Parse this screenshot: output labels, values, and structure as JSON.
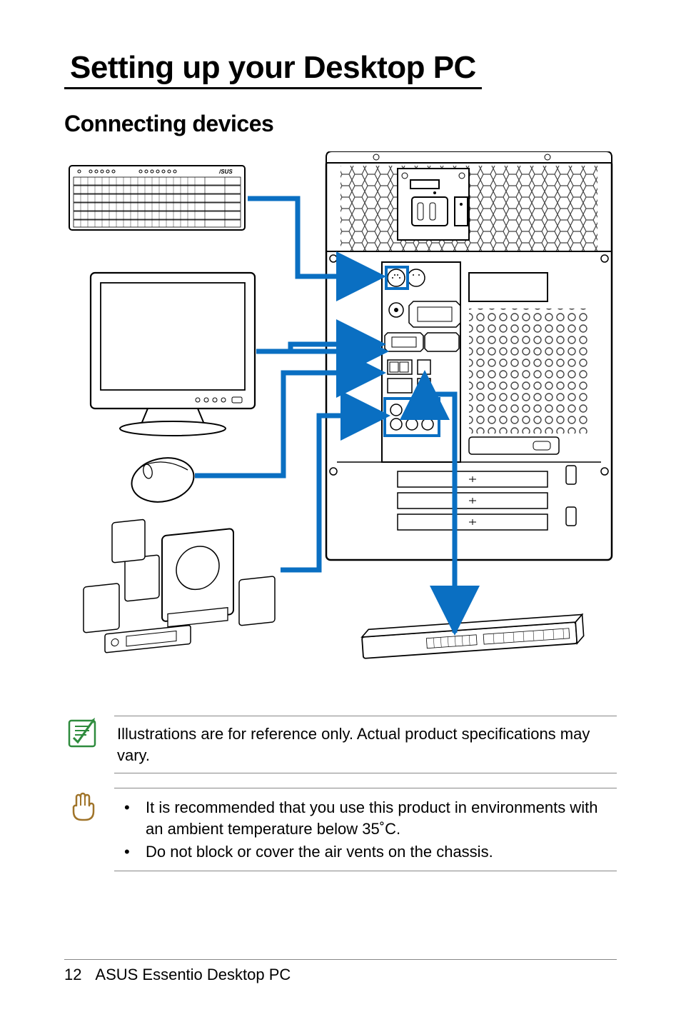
{
  "title": "Setting up your Desktop PC",
  "subtitle": "Connecting devices",
  "note1_text": "Illustrations are for reference only.  Actual product specifications may vary.",
  "note2_items": [
    "It is recommended that you use this product in environments with an ambient temperature below 35˚C.",
    "Do not block or cover the air vents on the chassis."
  ],
  "footer": {
    "page": "12",
    "product": "ASUS Essentio Desktop PC"
  }
}
